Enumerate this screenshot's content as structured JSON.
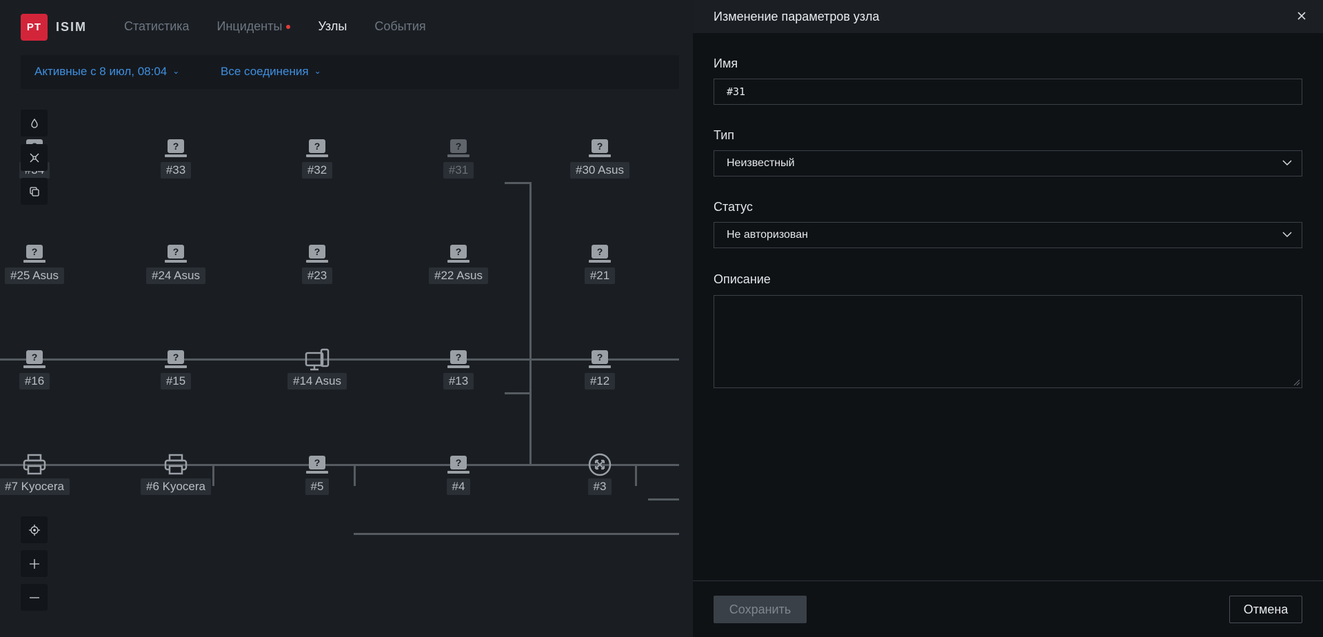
{
  "header": {
    "logo_mark": "PT",
    "logo_text": "ISIM",
    "nav": [
      {
        "label": "Статистика"
      },
      {
        "label": "Инциденты"
      },
      {
        "label": "Узлы"
      },
      {
        "label": "События"
      }
    ]
  },
  "filters": {
    "period": "Активные с 8 июл, 08:04",
    "connections": "Все соединения"
  },
  "map": {
    "nodes": [
      {
        "label": "#34",
        "type": "unknown-laptop"
      },
      {
        "label": "#33",
        "type": "unknown-laptop"
      },
      {
        "label": "#32",
        "type": "unknown-laptop"
      },
      {
        "label": "#31",
        "type": "unknown-laptop"
      },
      {
        "label": "#30 Asus",
        "type": "unknown-laptop"
      },
      {
        "label": "#25 Asus",
        "type": "unknown-laptop"
      },
      {
        "label": "#24 Asus",
        "type": "unknown-laptop"
      },
      {
        "label": "#23",
        "type": "unknown-laptop"
      },
      {
        "label": "#22 Asus",
        "type": "unknown-laptop"
      },
      {
        "label": "#21",
        "type": "unknown-laptop"
      },
      {
        "label": "#16",
        "type": "unknown-laptop"
      },
      {
        "label": "#15",
        "type": "unknown-laptop"
      },
      {
        "label": "#14 Asus",
        "type": "workstation"
      },
      {
        "label": "#13",
        "type": "unknown-laptop"
      },
      {
        "label": "#12",
        "type": "unknown-laptop"
      },
      {
        "label": "#7 Kyocera",
        "type": "printer"
      },
      {
        "label": "#6 Kyocera",
        "type": "printer"
      },
      {
        "label": "#5",
        "type": "unknown-laptop"
      },
      {
        "label": "#4",
        "type": "unknown-laptop"
      },
      {
        "label": "#3",
        "type": "router"
      }
    ]
  },
  "panel": {
    "title": "Изменение параметров узла",
    "name_label": "Имя",
    "name_value": "#31",
    "type_label": "Тип",
    "type_value": "Неизвестный",
    "status_label": "Статус",
    "status_value": "Не авторизован",
    "description_label": "Описание",
    "description_value": "",
    "save_label": "Сохранить",
    "cancel_label": "Отмена"
  },
  "colors": {
    "brand": "#d3253a",
    "link": "#3f8fe0",
    "alert_dot": "#e23b3b"
  }
}
